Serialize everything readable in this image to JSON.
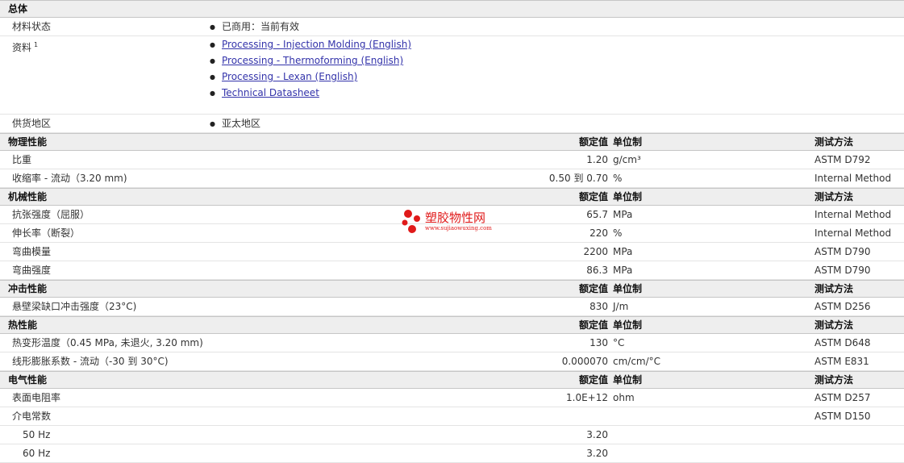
{
  "general": {
    "title": "总体",
    "status_label": "材料状态",
    "status_value": "已商用：当前有效",
    "docs_label": "资料",
    "docs_footnote": "1",
    "docs": [
      "Processing - Injection Molding (English)",
      "Processing - Thermoforming (English)",
      "Processing - Lexan (English)",
      "Technical Datasheet"
    ],
    "region_label": "供货地区",
    "region_value": "亚太地区"
  },
  "columns": {
    "value": "额定值",
    "unit": "单位制",
    "method": "测试方法"
  },
  "sections": [
    {
      "title": "物理性能",
      "rows": [
        {
          "label": "比重",
          "value": "1.20",
          "unit": "g/cm³",
          "method": "ASTM D792"
        },
        {
          "label": "收缩率 - 流动（3.20 mm)",
          "value": "0.50 到 0.70",
          "unit": "%",
          "method": "Internal Method"
        }
      ]
    },
    {
      "title": "机械性能",
      "rows": [
        {
          "label": "抗张强度（屈服）",
          "value": "65.7",
          "unit": "MPa",
          "method": "Internal Method"
        },
        {
          "label": "伸长率（断裂）",
          "value": "220",
          "unit": "%",
          "method": "Internal Method"
        },
        {
          "label": "弯曲模量",
          "value": "2200",
          "unit": "MPa",
          "method": "ASTM D790"
        },
        {
          "label": "弯曲强度",
          "value": "86.3",
          "unit": "MPa",
          "method": "ASTM D790"
        }
      ]
    },
    {
      "title": "冲击性能",
      "rows": [
        {
          "label": "悬壁梁缺口冲击强度（23°C)",
          "value": "830",
          "unit": "J/m",
          "method": "ASTM D256"
        }
      ]
    },
    {
      "title": "热性能",
      "rows": [
        {
          "label": "热变形温度（0.45 MPa, 未退火, 3.20 mm)",
          "value": "130",
          "unit": "°C",
          "method": "ASTM D648"
        },
        {
          "label": "线形膨胀系数 - 流动（-30 到 30°C)",
          "value": "0.000070",
          "unit": "cm/cm/°C",
          "method": "ASTM E831"
        }
      ]
    },
    {
      "title": "电气性能",
      "rows": [
        {
          "label": "表面电阻率",
          "value": "1.0E+12",
          "unit": "ohm",
          "method": "ASTM D257"
        },
        {
          "label": "介电常数",
          "value": "",
          "unit": "",
          "method": "ASTM D150"
        },
        {
          "label": "50 Hz",
          "value": "3.20",
          "unit": "",
          "method": "",
          "sub": true
        },
        {
          "label": "60 Hz",
          "value": "3.20",
          "unit": "",
          "method": "",
          "sub": true
        }
      ]
    }
  ],
  "watermark": {
    "name": "塑胶物性网",
    "url": "www.sujiaowuxing.com",
    "color": "#e01a1a"
  }
}
